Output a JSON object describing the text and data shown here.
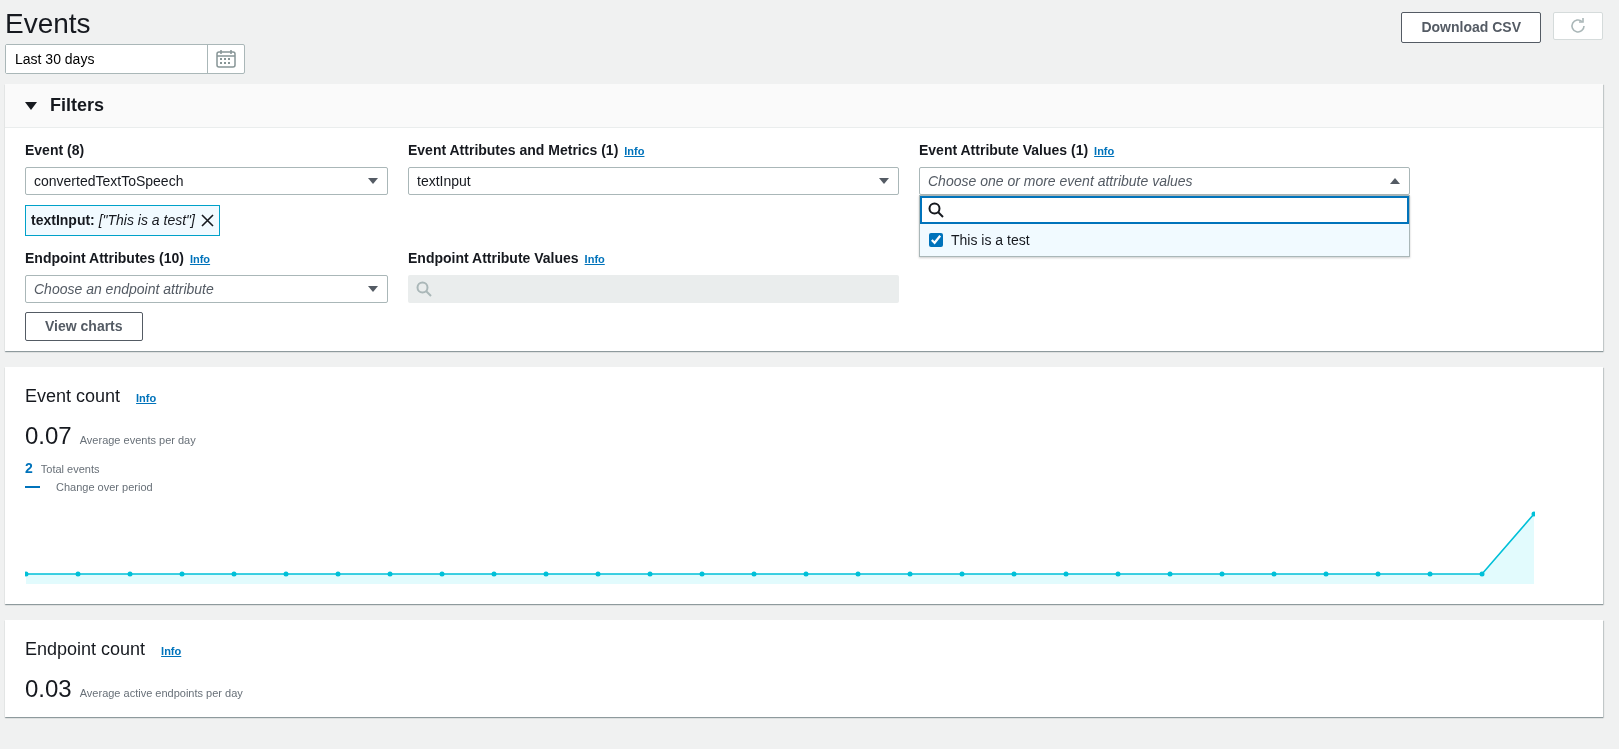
{
  "title": "Events",
  "date_range": {
    "value": "Last 30 days"
  },
  "download_button": "Download CSV",
  "filters": {
    "title": "Filters",
    "expanded": true,
    "event": {
      "label": "Event (8)",
      "value": "convertedTextToSpeech",
      "token": "**textInput:** *[\"This is a test\"]*"
    },
    "event_attributes": {
      "label": "Event Attributes and Metrics (1)",
      "info": "Info",
      "value": "textInput"
    },
    "event_attribute_values": {
      "label": "Event Attribute Values (1)",
      "info": "Info",
      "placeholder": "Choose one or more event attribute values",
      "expanded": true,
      "options": [
        {
          "label": "This is a test",
          "checked": true
        }
      ]
    },
    "endpoint_attributes": {
      "label": "Endpoint Attributes (10)",
      "info": "Info",
      "placeholder": "Choose an endpoint attribute"
    },
    "endpoint_attribute_values": {
      "label": "Endpoint Attribute Values",
      "info": "Info",
      "disabled": true
    },
    "view_button": "View charts"
  },
  "cards": [
    {
      "kind": "chart",
      "title": "Event count",
      "info": "Info",
      "value": "0.07",
      "caption": "Average events per day",
      "total": "2",
      "total_label": "Total events",
      "legend": "Change over period"
    },
    {
      "kind": "summary",
      "title": "Endpoint count",
      "info": "Info",
      "value": "0.03",
      "caption": "Average active endpoints per day"
    }
  ]
}
